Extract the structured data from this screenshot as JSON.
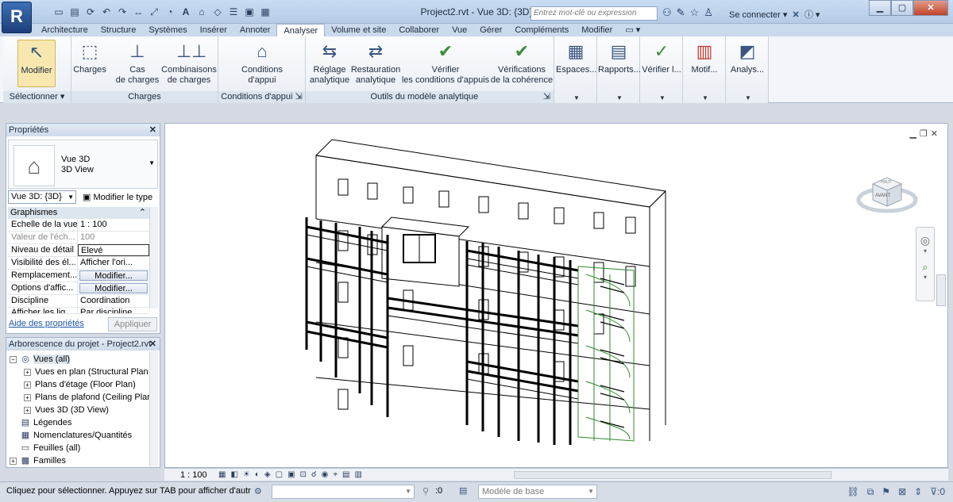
{
  "app": {
    "logo": "R",
    "title": "Project2.rvt - Vue 3D: {3D}",
    "search_placeholder": "Entrez mot-clé ou expression",
    "signin": "Se connecter"
  },
  "qat_icons": [
    "open-icon",
    "save-icon",
    "sync-icon",
    "undo-icon",
    "redo-icon",
    "measure-icon",
    "dimension-icon",
    "tag-icon",
    "text-icon",
    "3d-icon",
    "section-icon",
    "thin-lines-icon",
    "close-hidden-icon",
    "switch-windows-icon"
  ],
  "tabs": [
    "Architecture",
    "Structure",
    "Systèmes",
    "Insérer",
    "Annoter",
    "Analyser",
    "Volume et site",
    "Collaborer",
    "Vue",
    "Gérer",
    "Compléments",
    "Modifier"
  ],
  "active_tab": "Analyser",
  "ribbon": {
    "modify": "Modifier",
    "select_group": "Sélectionner",
    "charges_group": "Charges",
    "charges": "Charges",
    "cas_line1": "Cas",
    "cas_line2": "de charges",
    "combi_line1": "Combinaisons",
    "combi_line2": "de charges",
    "appui_group": "Conditions d'appui",
    "appui_line1": "Conditions",
    "appui_line2": "d'appui",
    "outils_group": "Outils du modèle analytique",
    "reglage_line1": "Réglage",
    "reglage_line2": "analytique",
    "restau_line1": "Restauration",
    "restau_line2": "analytique",
    "verifier_line1": "Vérifier",
    "verifier_line2": "les conditions d'appuis",
    "verif_line1": "Vérifications",
    "verif_line2": "de la cohérence",
    "espaces": "Espaces...",
    "rapports": "Rapports...",
    "verifierl": "Vérifier l...",
    "motif": "Motif...",
    "analys": "Analys..."
  },
  "properties": {
    "title": "Propriétés",
    "type_line1": "Vue 3D",
    "type_line2": "3D View",
    "view_select": "Vue 3D: {3D}",
    "edit_type": "Modifier le type",
    "section": "Graphismes",
    "rows": [
      {
        "k": "Echelle de la vue",
        "v": "1 : 100"
      },
      {
        "k": "Valeur de l'éch...",
        "v": "100"
      },
      {
        "k": "Niveau de détail",
        "v": "Elevé"
      },
      {
        "k": "Visibilité des él...",
        "v": "Afficher l'ori..."
      },
      {
        "k": "Remplacement...",
        "v": "Modifier..."
      },
      {
        "k": "Options d'affic...",
        "v": "Modifier..."
      },
      {
        "k": "Discipline",
        "v": "Coordination"
      },
      {
        "k": "Afficher les lig...",
        "v": "Par discipline"
      }
    ],
    "help": "Aide des propriétés",
    "apply": "Appliquer"
  },
  "browser": {
    "title": "Arborescence du projet - Project2.rvt",
    "nodes": [
      {
        "label": "Vues (all)"
      },
      {
        "label": "Vues en plan (Structural Plan"
      },
      {
        "label": "Plans d'étage (Floor Plan)"
      },
      {
        "label": "Plans de plafond (Ceiling Plan"
      },
      {
        "label": "Vues 3D (3D View)"
      },
      {
        "label": "Légendes"
      },
      {
        "label": "Nomenclatures/Quantités"
      },
      {
        "label": "Feuilles (all)"
      },
      {
        "label": "Familles"
      }
    ]
  },
  "viewcube": {
    "top": "HAUT",
    "front": "AVANT"
  },
  "view_control": {
    "scale": "1 : 100"
  },
  "status": {
    "message": "Cliquez pour sélectionner. Appuyez sur TAB pour afficher d'autres",
    "zero1": ":0",
    "model": "Modèle de base",
    "zero2": ":0"
  }
}
